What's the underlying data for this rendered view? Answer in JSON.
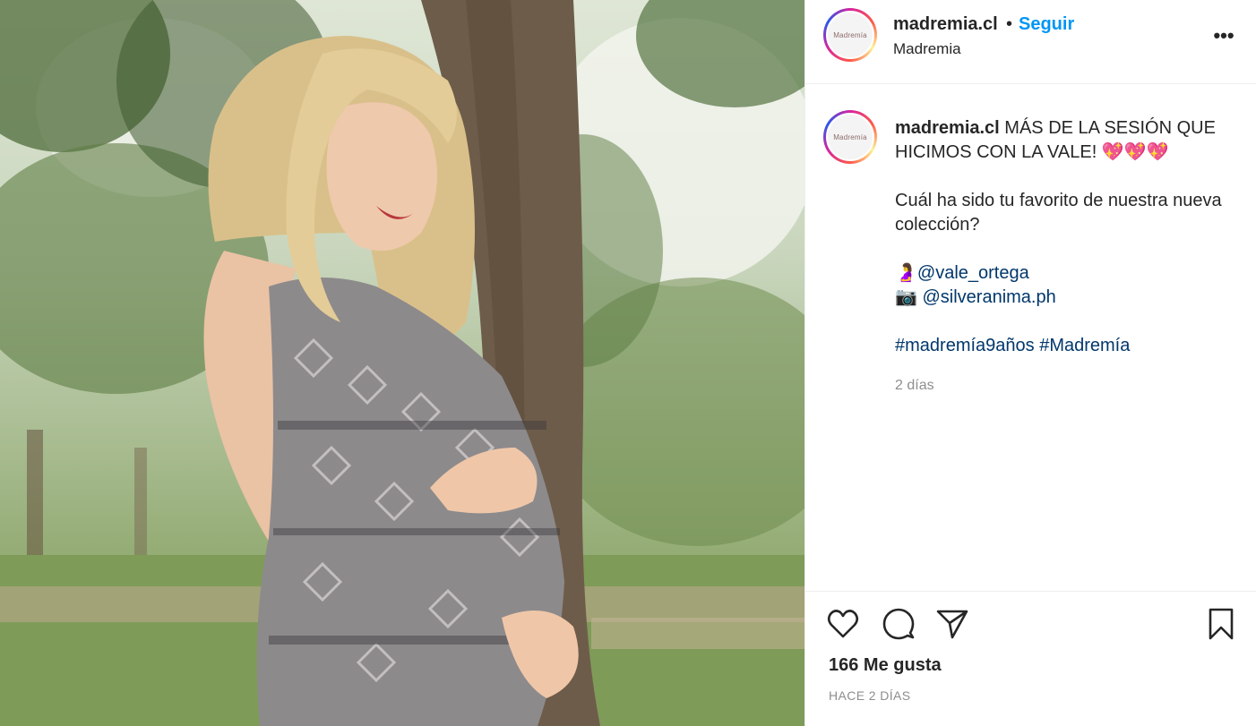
{
  "post": {
    "username": "madremia.cl",
    "separator": "•",
    "follow_label": "Seguir",
    "location": "Madremia",
    "avatar_text": "Madremía",
    "more_icon": "more-horizontal-icon"
  },
  "caption": {
    "username": "madremia.cl",
    "headline": "MÁS DE LA SESIÓN QUE HICIMOS CON LA VALE!",
    "headline_emoji": "💖💖💖",
    "question": "Cuál ha sido tu favorito de nuestra nueva colección?",
    "credit_1_emoji": "🤰",
    "credit_1": "@vale_ortega",
    "credit_2_emoji": "📷",
    "credit_2": "@silveranima.ph",
    "hashtags": "#madremía9años #Madremía",
    "time": "2 días"
  },
  "actions": {
    "like_icon": "heart-icon",
    "comment_icon": "comment-icon",
    "share_icon": "send-icon",
    "save_icon": "bookmark-icon",
    "likes": "166 Me gusta",
    "posted_ago": "HACE 2 DÍAS"
  },
  "colors": {
    "follow": "#0095f6",
    "link": "#00376b",
    "muted": "#8e8e8e",
    "divider": "#efefef"
  }
}
